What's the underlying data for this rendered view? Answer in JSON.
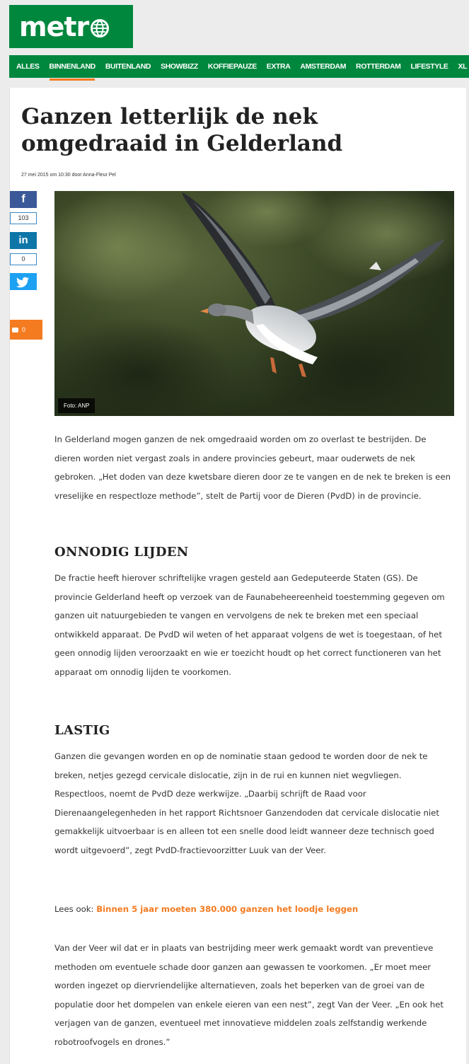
{
  "brand": {
    "logo_text": "metr",
    "color": "#00873e",
    "accent": "#f47b20"
  },
  "nav": {
    "items": [
      "ALLES",
      "BINNENLAND",
      "BUITENLAND",
      "SHOWBIZZ",
      "KOFFIEPAUZE",
      "EXTRA",
      "AMSTERDAM",
      "ROTTERDAM",
      "LIFESTYLE",
      "XL"
    ],
    "active": "BINNENLAND"
  },
  "article": {
    "title": "Ganzen letterlijk de nek omgedraaid in Gelderland",
    "byline": "27 mei 2015 om 10:30 door Anna-Fleur Pel",
    "photo_credit": "Foto: ANP",
    "paragraphs": [
      "In Gelderland mogen ganzen de nek omgedraaid worden om zo overlast te bestrijden. De dieren worden niet vergast zoals in andere provincies gebeurt, maar ouderwets de nek gebroken. „Het doden van deze kwetsbare dieren door ze te vangen en de nek te breken is een vreselijke en respectloze methode”, stelt de Partij voor de Dieren (PvdD) in de provincie.",
      "De fractie heeft hierover schriftelijke vragen gesteld aan Gedeputeerde Staten (GS). De provincie Gelderland heeft op verzoek van de Faunabeheereenheid toestemming gegeven om ganzen uit natuurgebieden te vangen en vervolgens de nek te breken met een speciaal ontwikkeld apparaat. De PvdD wil weten of het apparaat volgens de wet is toegestaan, of het geen onnodig lijden veroorzaakt en wie er toezicht houdt op het correct functioneren van het apparaat om onnodig lijden te voorkomen.",
      "Ganzen die gevangen worden en op de nominatie staan gedood te worden door de nek te breken, netjes gezegd cervicale dislocatie, zijn in de rui en kunnen niet wegvliegen. Respectloos, noemt de PvdD deze werkwijze. „Daarbij schrijft de Raad voor Dierenaangelegenheden in het rapport Richtsnoer Ganzendoden dat cervicale dislocatie niet gemakkelijk uitvoerbaar is en alleen tot een snelle dood leidt wanneer deze technisch goed wordt uitgevoerd”, zegt PvdD-fractievoorzitter Luuk van der Veer.",
      "Van der Veer wil dat er in plaats van bestrijding meer werk gemaakt wordt van preventieve methoden om eventuele schade door ganzen aan gewassen te voorkomen. „Er moet meer worden ingezet op diervriendelijke alternatieven, zoals het beperken van de groei van de populatie door het dompelen van enkele eieren van een nest”, zegt Van der Veer. „En ook het verjagen van de ganzen, eventueel met innovatieve middelen zoals zelfstandig werkende robotroofvogels en drones.”"
    ],
    "headings": [
      "ONNODIG LIJDEN",
      "LASTIG"
    ],
    "also_read": {
      "prefix": "Lees ook: ",
      "link": "Binnen 5 jaar moeten 380.000 ganzen het loodje leggen"
    }
  },
  "share": {
    "facebook_icon": "f",
    "facebook_count": "103",
    "linkedin_icon": "in",
    "linkedin_count": "0",
    "twitter_icon": "twitter-bird-icon",
    "comments_count": "0"
  }
}
